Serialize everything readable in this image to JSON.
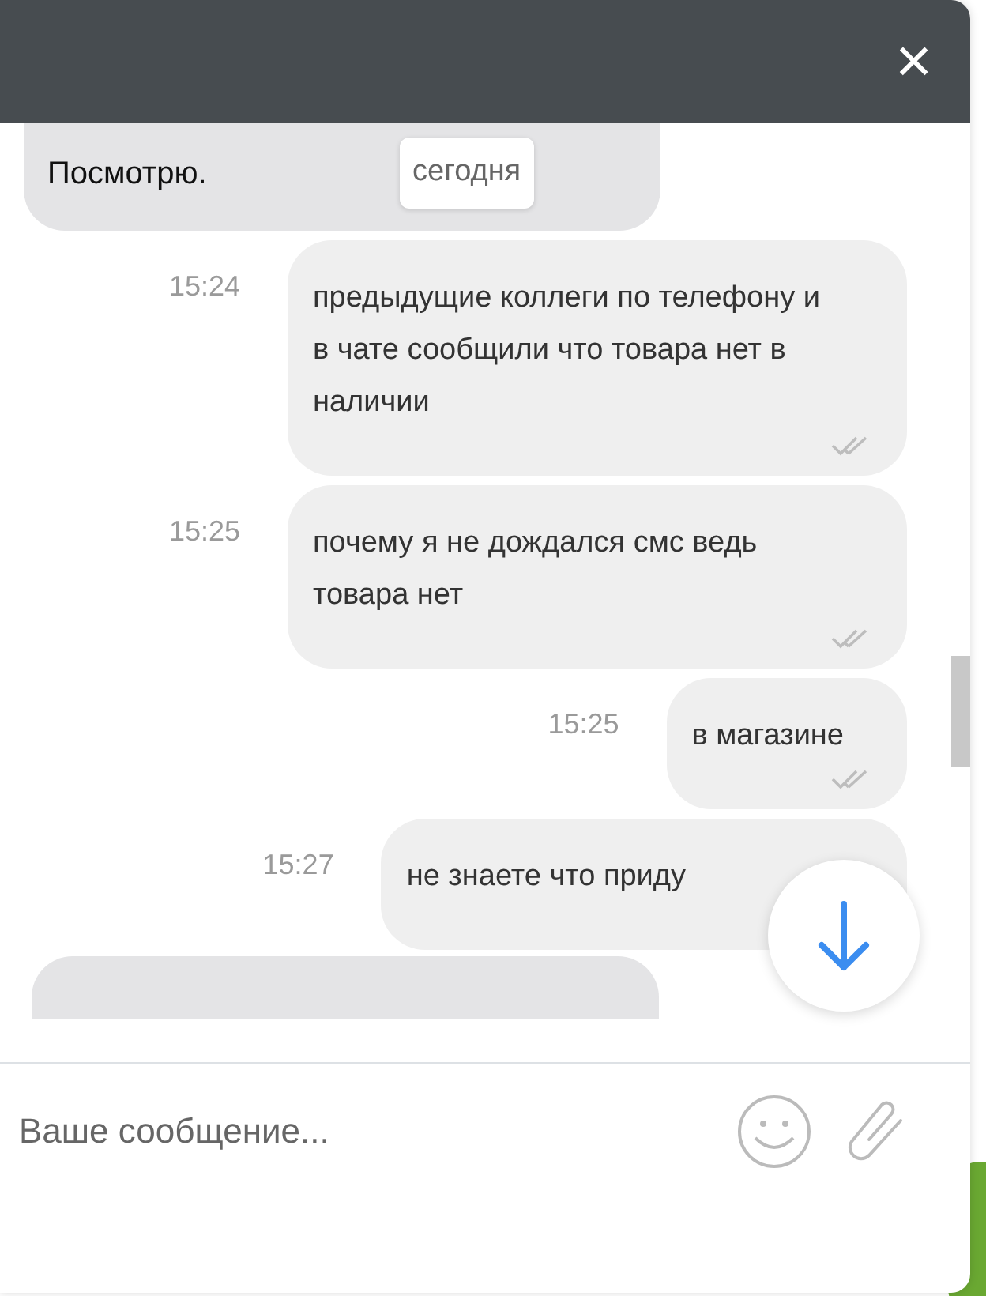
{
  "header": {
    "close": "×"
  },
  "date_chip": "сегодня",
  "messages": [
    {
      "kind": "incoming",
      "text": "Посмотрю."
    },
    {
      "kind": "outgoing",
      "time": "15:24",
      "text": "предыдущие коллеги по телефону и в чате сообщили что товара нет в наличии",
      "read": true
    },
    {
      "kind": "outgoing",
      "time": "15:25",
      "text": "почему я не дождался смс ведь товара нет",
      "read": true
    },
    {
      "kind": "outgoing",
      "time": "15:25",
      "text": "в магазине",
      "read": true
    },
    {
      "kind": "outgoing",
      "time": "15:27",
      "text": "не знаете что приду"
    },
    {
      "kind": "incoming_cut"
    }
  ],
  "composer": {
    "placeholder": "Ваше сообщение..."
  }
}
